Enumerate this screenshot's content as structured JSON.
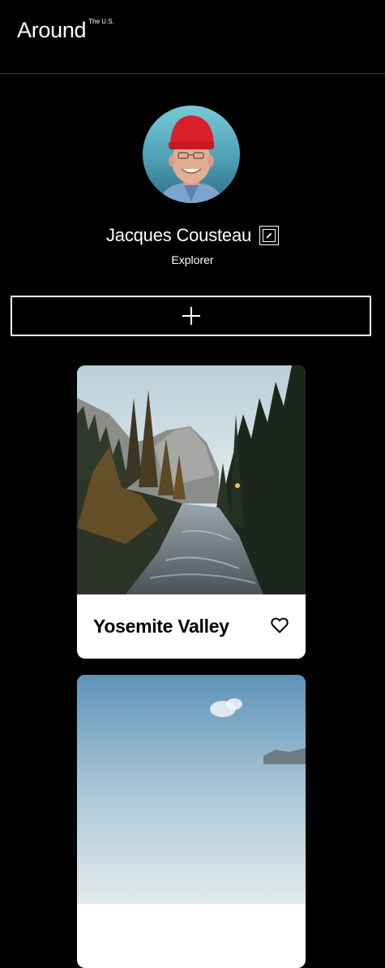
{
  "header": {
    "logo_text": "Around",
    "logo_superscript": "The U.S."
  },
  "profile": {
    "name": "Jacques Cousteau",
    "about": "Explorer"
  },
  "cards": [
    {
      "title": "Yosemite Valley",
      "liked": false
    },
    {
      "title": "",
      "liked": false
    }
  ],
  "colors": {
    "background": "#000000",
    "card_background": "#ffffff",
    "text": "#ffffff",
    "card_text": "#000000"
  },
  "icons": {
    "edit": "pencil-icon",
    "add": "plus-icon",
    "like": "heart-icon"
  }
}
